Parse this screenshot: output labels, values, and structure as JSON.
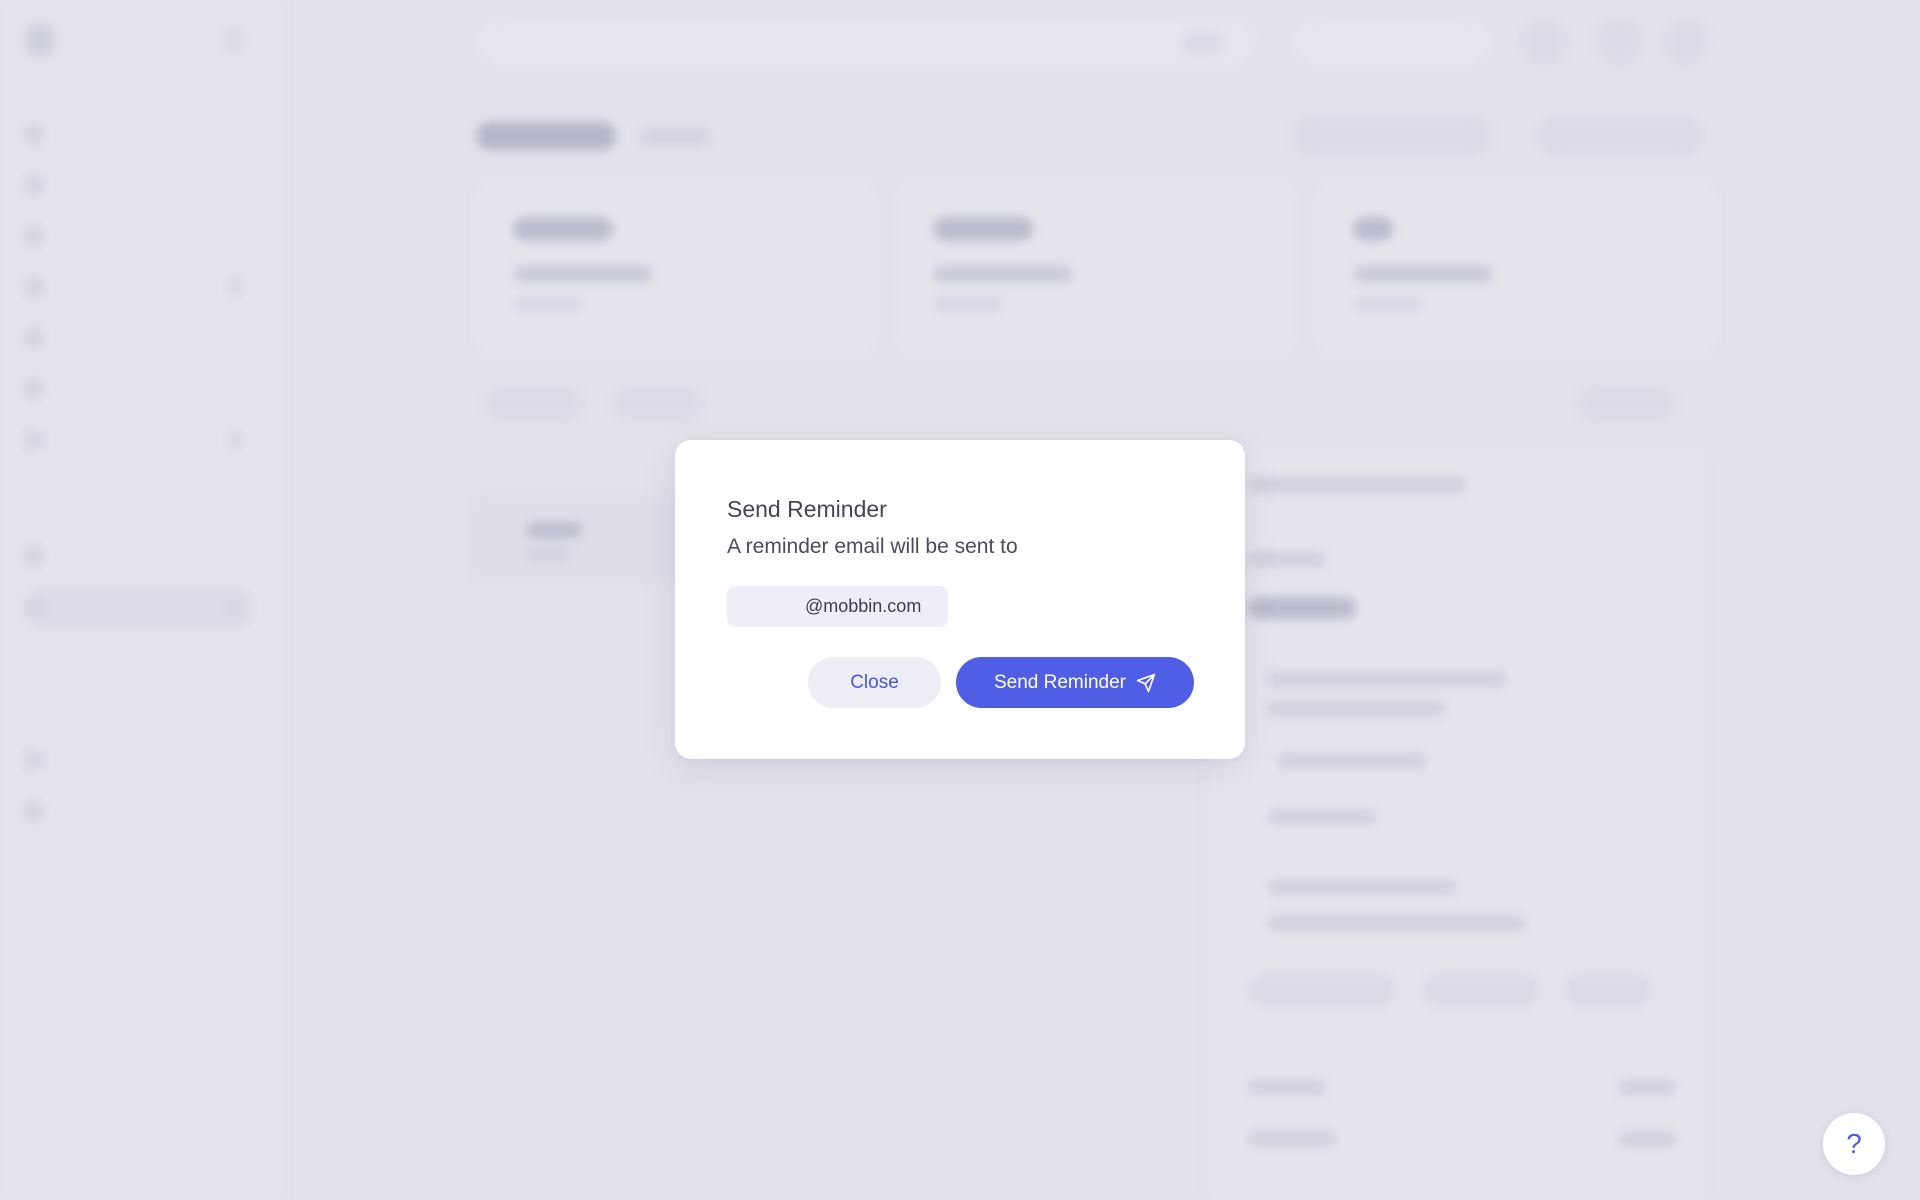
{
  "modal": {
    "title": "Send Reminder",
    "description": "A reminder email will be sent to",
    "email_domain": "@mobbin.com",
    "close_label": "Close",
    "send_label": "Send Reminder",
    "send_icon": "paper-plane-icon"
  },
  "help": {
    "label": "?",
    "icon": "question-mark-icon"
  },
  "colors": {
    "accent": "#4f5ee4",
    "backdrop": "#e2e2ec",
    "modal_bg": "#ffffff",
    "email_chip_bg": "#eeeef8"
  }
}
